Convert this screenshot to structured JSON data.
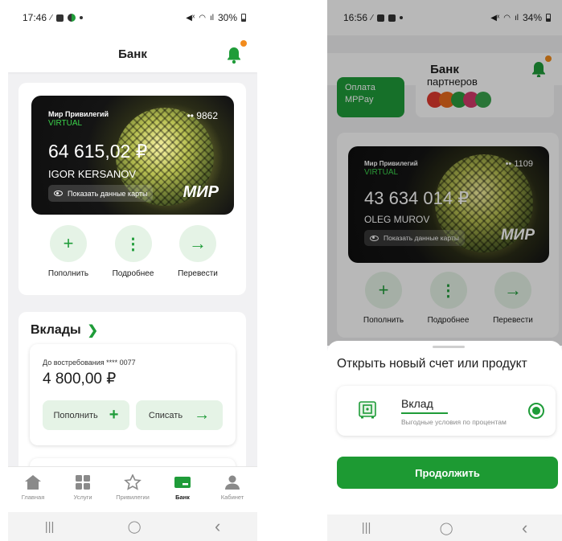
{
  "left_screen": {
    "status": {
      "time": "17:46",
      "battery": "30%"
    },
    "header": {
      "title": "Банк"
    },
    "card": {
      "brand": "Мир Привилегий",
      "type": "VIRTUAL",
      "number_masked": "•• 9862",
      "balance": "64 615,02 ₽",
      "holder": "IGOR KERSANOV",
      "show_data": "Показать данные карты",
      "payment_system": "МИР"
    },
    "actions": [
      {
        "label": "Пополнить",
        "icon": "plus-icon",
        "glyph": "+"
      },
      {
        "label": "Подробнее",
        "icon": "more-vertical-icon",
        "glyph": "⋮"
      },
      {
        "label": "Перевести",
        "icon": "arrow-right-icon",
        "glyph": "→"
      }
    ],
    "deposits": {
      "title": "Вклады",
      "item": {
        "label": "До востребования **** 0077",
        "amount": "4 800,00 ₽",
        "topup_label": "Пополнить",
        "withdraw_label": "Списать"
      }
    },
    "tabbar": [
      {
        "label": "Главная",
        "icon": "home-icon",
        "active": false
      },
      {
        "label": "Услуги",
        "icon": "grid-icon",
        "active": false
      },
      {
        "label": "Привилегии",
        "icon": "star-icon",
        "active": false
      },
      {
        "label": "Банк",
        "icon": "bank-card-icon",
        "active": true
      },
      {
        "label": "Кабинет",
        "icon": "profile-icon",
        "active": false
      }
    ],
    "navbar": {
      "recents": "|||",
      "home": "◯",
      "back": "‹"
    }
  },
  "right_screen": {
    "status": {
      "time": "16:56",
      "battery": "34%"
    },
    "header": {
      "title": "Банк"
    },
    "partner_tile": {
      "label": "Оплата MPPay",
      "partners_label": "партнеров"
    },
    "card": {
      "brand": "Мир Привилегий",
      "type": "VIRTUAL",
      "number_masked": "•• 1109",
      "balance": "43 634 014 ₽",
      "holder": "OLEG MUROV",
      "show_data": "Показать данные карты",
      "payment_system": "МИР"
    },
    "actions": [
      {
        "label": "Пополнить",
        "glyph": "+"
      },
      {
        "label": "Подробнее",
        "glyph": "⋮"
      },
      {
        "label": "Перевести",
        "glyph": "→"
      }
    ],
    "sheet": {
      "title": "Открыть новый счет или продукт",
      "product": {
        "title": "Вклад",
        "subtitle": "Выгодные условия по процентам",
        "selected": true
      },
      "continue_label": "Продолжить"
    },
    "navbar": {
      "recents": "|||",
      "home": "◯",
      "back": "‹"
    }
  },
  "colors": {
    "accent": "#1f9c39",
    "accent_light": "#e5f3e6",
    "notification": "#f28b1c",
    "card_dark": "#141414"
  }
}
